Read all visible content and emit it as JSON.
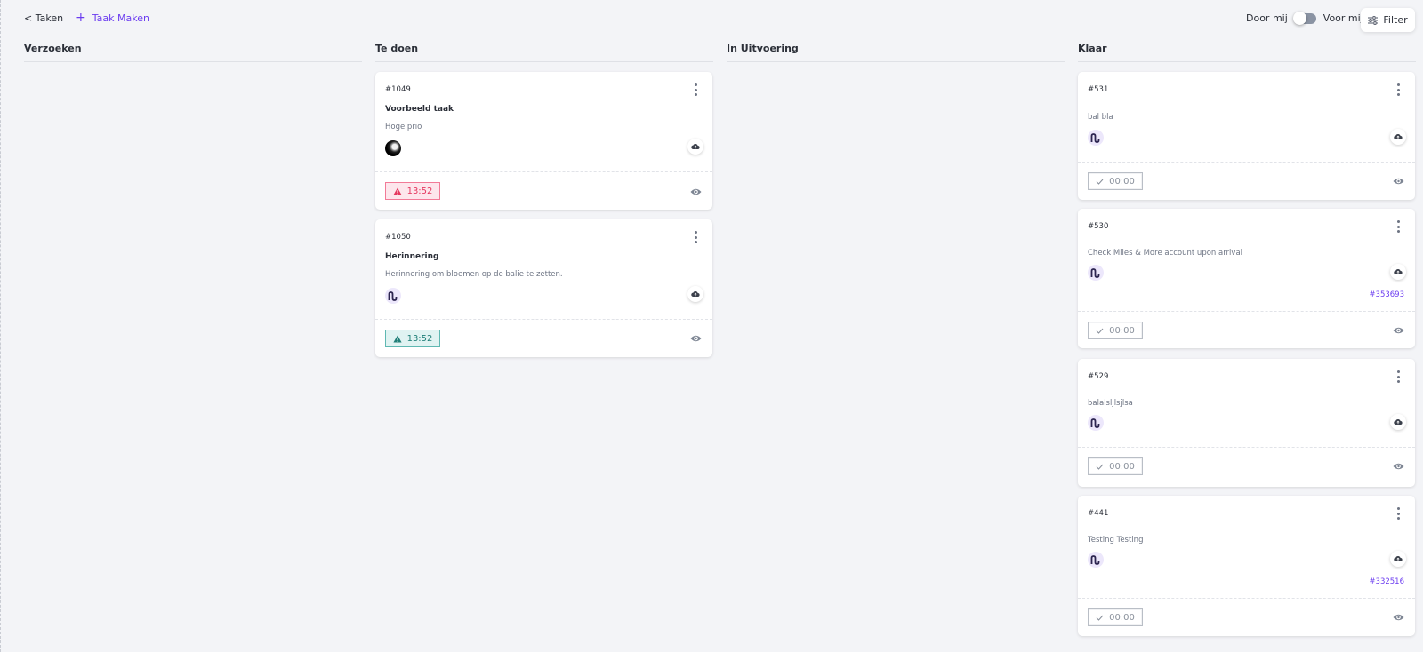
{
  "header": {
    "back_label": "< Taken",
    "create_label": "Taak Maken",
    "toggle_left": "Door mij",
    "toggle_right": "Voor mij",
    "filter_label": "Filter"
  },
  "columns": [
    {
      "title": "Verzoeken",
      "cards": []
    },
    {
      "title": "Te doen",
      "cards": [
        {
          "id": "#1049",
          "title": "Voorbeeld taak",
          "description": "Hoge prio",
          "avatar": "photo",
          "timer": "13:52",
          "timer_status": "red"
        },
        {
          "id": "#1050",
          "title": "Herinnering",
          "description": "Herinnering om bloemen op de balie te zetten.",
          "avatar": "logo",
          "timer": "13:52",
          "timer_status": "teal"
        }
      ]
    },
    {
      "title": "In Uitvoering",
      "cards": []
    },
    {
      "title": "Klaar",
      "cards": [
        {
          "id": "#531",
          "description": "bal bla",
          "avatar": "logo",
          "timer": "00:00",
          "timer_status": "done"
        },
        {
          "id": "#530",
          "description": "Check Miles & More account upon arrival",
          "avatar": "logo",
          "reference": "#353693",
          "timer": "00:00",
          "timer_status": "done"
        },
        {
          "id": "#529",
          "description": "balalsljlsjlsa",
          "avatar": "logo",
          "timer": "00:00",
          "timer_status": "done"
        },
        {
          "id": "#441",
          "description": "Testing Testing",
          "avatar": "logo",
          "reference": "#332516",
          "timer": "00:00",
          "timer_status": "done"
        }
      ]
    }
  ],
  "colors": {
    "accent": "#6b3cf0",
    "overdue": "#e5385f",
    "pending": "#1f7f78",
    "done": "#8a919c"
  },
  "icons": [
    "plus-icon",
    "filter-sliders-icon",
    "more-vertical-icon",
    "cloud-upload-icon",
    "warning-triangle-icon",
    "check-icon",
    "eye-icon",
    "company-logo-icon"
  ]
}
